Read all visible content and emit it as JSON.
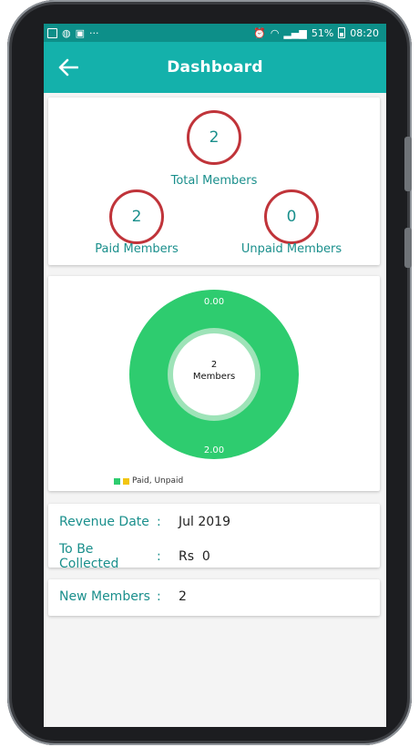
{
  "statusbar": {
    "left_icons": [
      "image-icon",
      "dribbble-icon",
      "outlook-icon",
      "more-icon"
    ],
    "more": "···",
    "battery_text": "51%",
    "time": "08:20"
  },
  "appbar": {
    "title": "Dashboard",
    "back_icon": "arrow-left-icon"
  },
  "stats": {
    "total": {
      "value": "2",
      "label": "Total Members"
    },
    "paid": {
      "value": "2",
      "label": "Paid Members"
    },
    "unpaid": {
      "value": "0",
      "label": "Unpaid Members"
    },
    "ring_color": "#c0343a",
    "text_color": "#1a8f8c"
  },
  "chart_data": {
    "type": "pie",
    "donut": true,
    "categories": [
      "Paid",
      "Unpaid"
    ],
    "values": [
      2.0,
      0.0
    ],
    "value_labels": [
      "2.00",
      "0.00"
    ],
    "center_label": [
      "2",
      "Members"
    ],
    "legend_text": "Paid, Unpaid",
    "legend_placement": "bottom-left",
    "colors": [
      "#2ecc6f",
      "#f2c511"
    ]
  },
  "revenue": {
    "date_label": "Revenue Date",
    "date_value": "Jul 2019",
    "collect_label": "To Be Collected",
    "collect_value": "Rs  0",
    "colon": ":"
  },
  "new_members": {
    "label": "New Members",
    "value": "2",
    "colon": ":"
  },
  "colors": {
    "primary": "#14b1ab",
    "status_bar": "#0d8f89",
    "accent_text": "#1a8f8c"
  }
}
